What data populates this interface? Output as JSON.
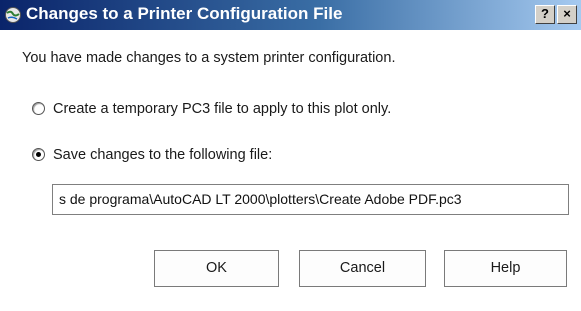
{
  "window": {
    "title": "Changes to a Printer Configuration File",
    "help_glyph": "?",
    "close_glyph": "×"
  },
  "message": "You have made changes to a system printer configuration.",
  "options": [
    {
      "label": "Create a temporary PC3 file to apply to this plot only.",
      "selected": false
    },
    {
      "label": "Save changes to the following file:",
      "selected": true
    }
  ],
  "file_path": "s de programa\\AutoCAD LT 2000\\plotters\\Create Adobe PDF.pc3",
  "buttons": {
    "ok": "OK",
    "cancel": "Cancel",
    "help": "Help"
  },
  "icons": {
    "title": "printer-globe-icon"
  },
  "colors": {
    "titlebar_start": "#0a246a",
    "titlebar_end": "#a6caf0",
    "dialog_bg": "#ffffff"
  }
}
